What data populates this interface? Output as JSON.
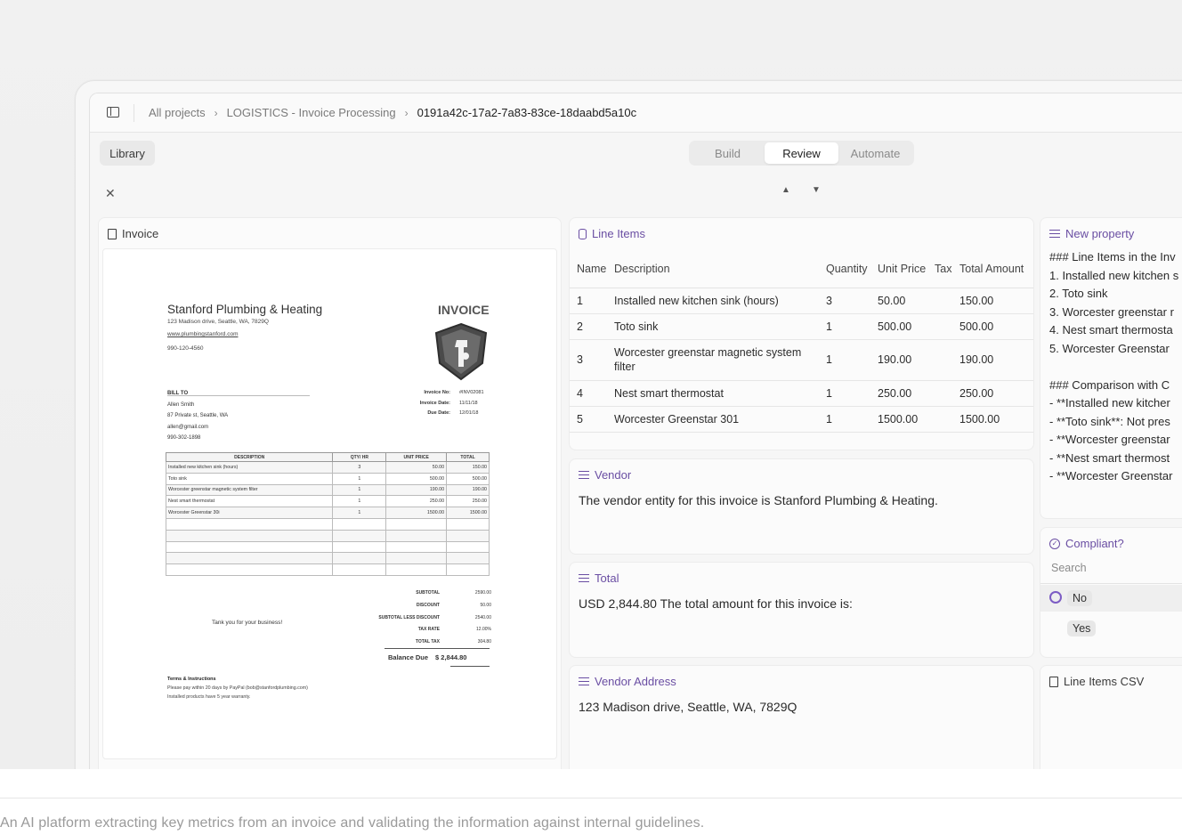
{
  "breadcrumb": {
    "items": [
      "All projects",
      "LOGISTICS - Invoice Processing",
      "0191a42c-17a2-7a83-83ce-18daabd5a10c"
    ]
  },
  "toolbar": {
    "library_label": "Library",
    "tabs": [
      "Build",
      "Review",
      "Automate"
    ],
    "active_tab": "Review"
  },
  "icons": {
    "close": "close-icon",
    "up": "chevron-up-icon",
    "down": "chevron-down-icon"
  },
  "invoice_panel": {
    "title": "Invoice",
    "document": {
      "company": "Stanford Plumbing & Heating",
      "address": "123 Madison drive, Seattle, WA, 7829Q",
      "website": "www.plumbingstanford.com",
      "phone": "990-120-4560",
      "heading": "INVOICE",
      "bill_to_label": "BILL TO",
      "bill_to": [
        "Allen Smith",
        "87 Private st, Seattle, WA",
        "allen@gmail.com",
        "990-302-1898"
      ],
      "meta": [
        {
          "k": "Invoice No:",
          "v": "#INV02081"
        },
        {
          "k": "Invoice Date:",
          "v": "11/11/18"
        },
        {
          "k": "Due Date:",
          "v": "12/01/18"
        }
      ],
      "table_headers": [
        "DESCRIPTION",
        "QTY/ HR",
        "UNIT PRICE",
        "TOTAL"
      ],
      "rows": [
        [
          "Installed new kitchen sink (hours)",
          "3",
          "50.00",
          "150.00"
        ],
        [
          "Toto sink",
          "1",
          "500.00",
          "500.00"
        ],
        [
          "Worcester greenstar magnetic system filter",
          "1",
          "190.00",
          "190.00"
        ],
        [
          "Nest smart thermostat",
          "1",
          "250.00",
          "250.00"
        ],
        [
          "Worcester Greenstar 30i",
          "1",
          "1500.00",
          "1500.00"
        ],
        [
          "",
          "",
          "",
          ""
        ],
        [
          "",
          "",
          "",
          ""
        ],
        [
          "",
          "",
          "",
          ""
        ],
        [
          "",
          "",
          "",
          ""
        ],
        [
          "",
          "",
          "",
          ""
        ]
      ],
      "summary": [
        {
          "k": "SUBTOTAL",
          "v": "2590.00"
        },
        {
          "k": "DISCOUNT",
          "v": "50.00"
        },
        {
          "k": "SUBTOTAL LESS DISCOUNT",
          "v": "2540.00"
        },
        {
          "k": "TAX RATE",
          "v": "12.00%"
        },
        {
          "k": "TOTAL TAX",
          "v": "304.80"
        }
      ],
      "balance_label": "Balance Due",
      "balance_value": "$ 2,844.80",
      "thanks": "Tank you for your business!",
      "terms_title": "Terms & Instructions",
      "terms": [
        "Please pay within 20 days by PayPal (bob@stanfordplumbing.com)",
        "Installed products have 5 year warranty."
      ]
    }
  },
  "line_items": {
    "title": "Line Items",
    "headers": [
      "Name",
      "Description",
      "Quantity",
      "Unit Price",
      "Tax",
      "Total Amount"
    ],
    "rows": [
      [
        "1",
        "Installed new kitchen sink (hours)",
        "3",
        "50.00",
        "",
        "150.00"
      ],
      [
        "2",
        "Toto sink",
        "1",
        "500.00",
        "",
        "500.00"
      ],
      [
        "3",
        "Worcester greenstar magnetic system filter",
        "1",
        "190.00",
        "",
        "190.00"
      ],
      [
        "4",
        "Nest smart thermostat",
        "1",
        "250.00",
        "",
        "250.00"
      ],
      [
        "5",
        "Worcester Greenstar 301",
        "1",
        "1500.00",
        "",
        "1500.00"
      ]
    ]
  },
  "vendor": {
    "title": "Vendor",
    "text": "The vendor entity for this invoice is Stanford Plumbing & Heating."
  },
  "total": {
    "title": "Total",
    "text": "USD 2,844.80 The total amount for this invoice is:"
  },
  "vendor_address": {
    "title": "Vendor Address",
    "text": "123 Madison drive, Seattle, WA, 7829Q"
  },
  "new_property": {
    "title": "New property",
    "lines": [
      "### Line Items in the Inv",
      "1. Installed new kitchen s",
      "2. Toto sink",
      "3. Worcester greenstar r",
      "4. Nest smart thermosta",
      "5. Worcester Greenstar",
      "",
      "### Comparison with C",
      "- **Installed new kitcher",
      "- **Toto sink**: Not pres",
      "- **Worcester greenstar",
      "- **Nest smart thermost",
      "- **Worcester Greenstar"
    ]
  },
  "compliant": {
    "title": "Compliant?",
    "search_placeholder": "Search",
    "options": [
      "No",
      "Yes"
    ],
    "selected": "No"
  },
  "line_items_csv": {
    "title": "Line Items CSV"
  },
  "caption": "An AI platform extracting key metrics from an invoice and validating the information against internal guidelines."
}
